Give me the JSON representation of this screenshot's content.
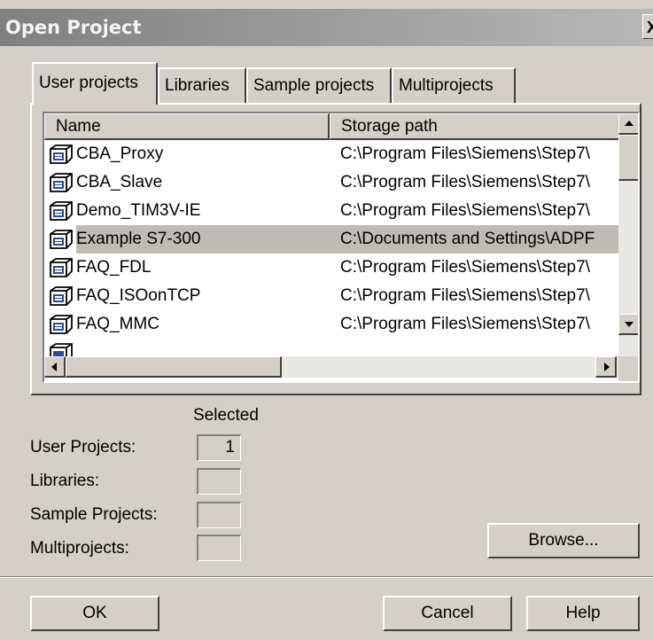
{
  "window": {
    "title": "Open Project",
    "close_glyph": "X"
  },
  "tabs": [
    {
      "label": "User projects",
      "active": true
    },
    {
      "label": "Libraries",
      "active": false
    },
    {
      "label": "Sample projects",
      "active": false
    },
    {
      "label": "Multiprojects",
      "active": false
    }
  ],
  "list": {
    "columns": [
      "Name",
      "Storage path"
    ],
    "rows": [
      {
        "name": "CBA_Proxy",
        "path": "C:\\Program Files\\Siemens\\Step7\\",
        "selected": false
      },
      {
        "name": "CBA_Slave",
        "path": "C:\\Program Files\\Siemens\\Step7\\",
        "selected": false
      },
      {
        "name": "Demo_TIM3V-IE",
        "path": "C:\\Program Files\\Siemens\\Step7\\",
        "selected": false
      },
      {
        "name": "Example S7-300",
        "path": "C:\\Documents and Settings\\ADPF",
        "selected": true
      },
      {
        "name": "FAQ_FDL",
        "path": "C:\\Program Files\\Siemens\\Step7\\",
        "selected": false
      },
      {
        "name": "FAQ_ISOonTCP",
        "path": "C:\\Program Files\\Siemens\\Step7\\",
        "selected": false
      },
      {
        "name": "FAQ_MMC",
        "path": "C:\\Program Files\\Siemens\\Step7\\",
        "selected": false
      }
    ],
    "row_icon": "project-icon"
  },
  "selection": {
    "heading": "Selected",
    "user_projects_label": "User Projects:",
    "user_projects_count": "1",
    "libraries_label": "Libraries:",
    "libraries_count": "",
    "sample_projects_label": "Sample Projects:",
    "sample_projects_count": "",
    "multiprojects_label": "Multiprojects:",
    "multiprojects_count": ""
  },
  "buttons": {
    "browse": "Browse...",
    "ok": "OK",
    "cancel": "Cancel",
    "help": "Help"
  },
  "colors": {
    "dialog_bg": "#d4d0c8",
    "selected_row": "#c0bcb4",
    "title_gradient_start": "#808080"
  }
}
